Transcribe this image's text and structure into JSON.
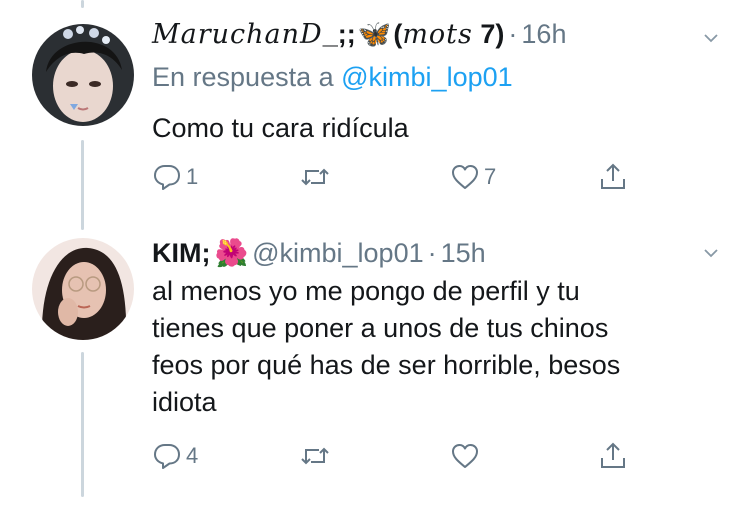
{
  "tweets": [
    {
      "display_name_script": "MaruchanD",
      "display_name_suffix": "_;;",
      "display_name_emoji": "🦋",
      "display_name_paren_script": "mots",
      "display_name_paren_end": " 7)",
      "display_name_paren_open": "(",
      "separator": "·",
      "time": "16h",
      "reply_prefix": "En respuesta a",
      "reply_handle": "@kimbi_lop01",
      "text": "Como tu cara ridícula",
      "actions": {
        "reply_count": "1",
        "retweet_count": "",
        "like_count": "7"
      }
    },
    {
      "display_name": "KIM;",
      "display_name_emoji": "🌺",
      "handle": "@kimbi_lop01",
      "separator": "·",
      "time": "15h",
      "text_lines": [
        "al menos yo me pongo de perfil y tu",
        "tienes que poner a unos de tus chinos",
        "feos por qué has de ser horrible, besos",
        "idiota"
      ],
      "actions": {
        "reply_count": "4",
        "retweet_count": "",
        "like_count": ""
      }
    }
  ],
  "icons": {
    "reply": "comment-bubble-icon",
    "retweet": "retweet-icon",
    "like": "heart-icon",
    "share": "share-icon",
    "menu": "chevron-down-icon"
  },
  "colors": {
    "text": "#14171a",
    "secondary": "#657786",
    "link": "#1da1f2",
    "thread_line": "#ccd6dd"
  }
}
